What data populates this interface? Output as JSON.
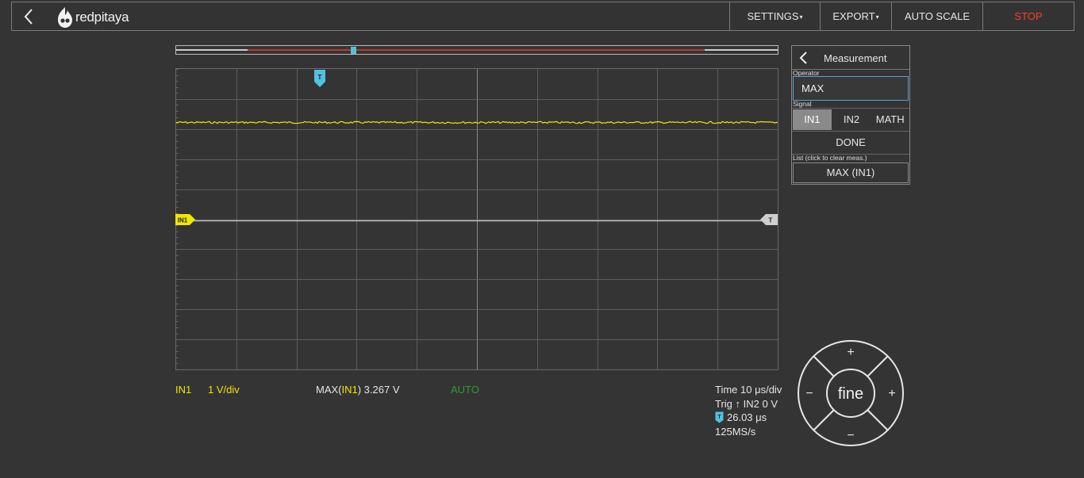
{
  "header": {
    "logo_text": "redpitaya",
    "menu": [
      {
        "label": "SETTINGS",
        "caret": "▾",
        "width": 114
      },
      {
        "label": "EXPORT",
        "caret": "▾",
        "width": 90
      },
      {
        "label": "AUTO SCALE",
        "caret": "",
        "width": 115
      },
      {
        "label": "STOP",
        "caret": "",
        "width": 115
      }
    ]
  },
  "plot": {
    "trigger_marker_label": "T",
    "channel_marker_label": "IN1",
    "trigger_level_label": "T",
    "colors": {
      "signal": "#f4e500",
      "grid": "#5e5e5e",
      "center": "#8c8c8c",
      "trigger": "#4fc3e0"
    }
  },
  "channel_info": {
    "channel": "IN1",
    "scale": "1 V/div",
    "measurement_prefix": "MAX(",
    "measurement_channel": "IN1",
    "measurement_suffix": ") 3.267 V",
    "trigger_mode": "AUTO"
  },
  "timebase": {
    "time": "Time 10 μs/div",
    "trig_prefix": "Trig",
    "trig_arrow": "↑",
    "trig_value": "IN2 0 V",
    "trig_marker": "T",
    "offset": "26.03 μs",
    "sample_rate": "125MS/s"
  },
  "measurement_panel": {
    "title": "Measurement",
    "operator_label": "Operator",
    "operator_value": "MAX",
    "signal_label": "Signal",
    "signals": [
      "IN1",
      "IN2",
      "MATH"
    ],
    "active_signal": "IN1",
    "done_label": "DONE",
    "list_label": "List (click to clear meas.)",
    "list_items": [
      "MAX (IN1)"
    ]
  },
  "wheel": {
    "center_label": "fine",
    "up": "+",
    "down": "−",
    "left": "−",
    "right": "+"
  }
}
